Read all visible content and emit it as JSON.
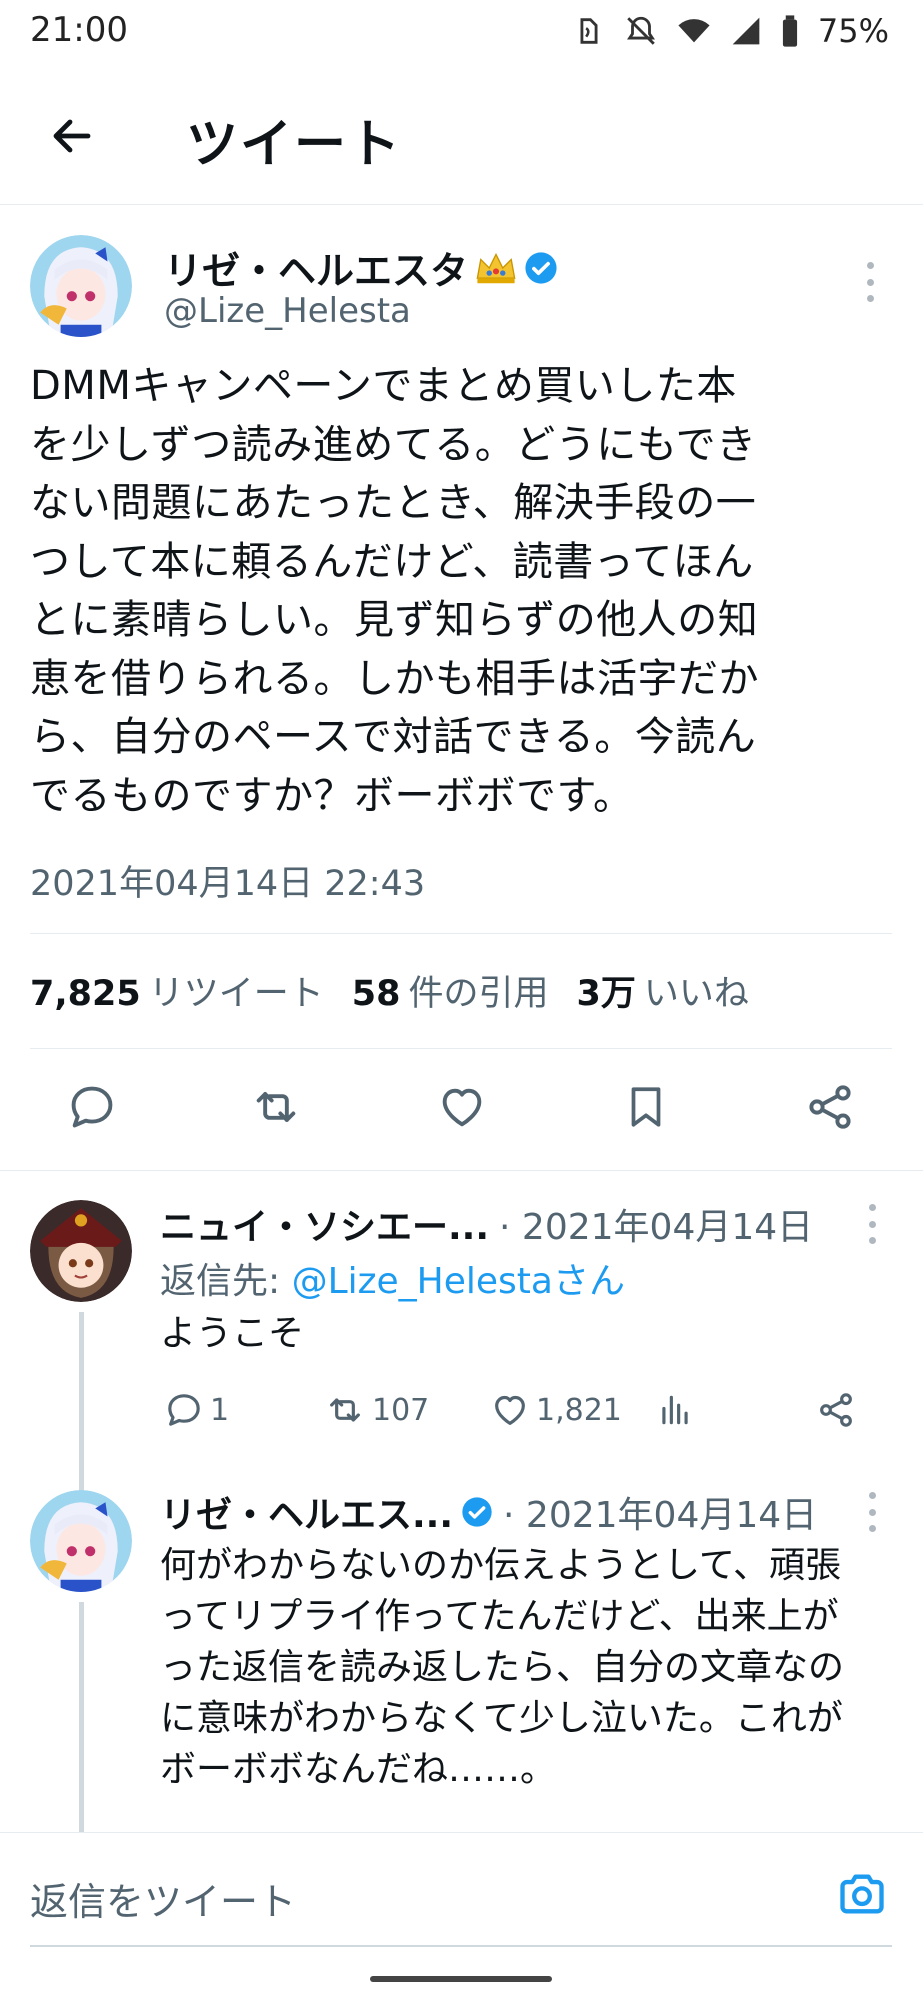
{
  "status_bar": {
    "time": "21:00",
    "battery": "75%"
  },
  "header": {
    "title": "ツイート"
  },
  "main_tweet": {
    "author_name": "リゼ・ヘルエスタ",
    "author_handle": "@Lize_Helesta",
    "text_lines": [
      "DMMキャンペーンでまとめ買いした本",
      "を少しずつ読み進めてる。どうにもでき",
      "ない問題にあたったとき、解決手段の一",
      "つして本に頼るんだけど、読書ってほん",
      "とに素晴らしい。見ず知らずの他人の知",
      "恵を借りられる。しかも相手は活字だか",
      "ら、自分のペースで対話できる。今読ん",
      "でるものですか？ボーボボです。"
    ],
    "timestamp": "2021年04月14日 22:43",
    "stats": {
      "retweets_num": "7,825",
      "retweets_label": "リツイート",
      "quotes_num": "58",
      "quotes_label": "件の引用",
      "likes_num": "3万",
      "likes_label": "いいね"
    }
  },
  "replies": [
    {
      "author_name": "ニュイ・ソシエー...",
      "date": "· 2021年04月14日",
      "reply_to_prefix": "返信先: ",
      "reply_to_mention": "@Lize_Helestaさん",
      "text": "ようこそ",
      "reply_count": "1",
      "retweet_count": "107",
      "like_count": "1,821"
    },
    {
      "author_name": "リゼ・ヘルエス...",
      "date": "· 2021年04月14日",
      "text_lines": [
        "何がわからないのか伝えようとして、頑張",
        "ってリプライ作ってたんだけど、出来上が",
        "った返信を読み返したら、自分の文章なの",
        "に意味がわからなくて少し泣いた。これが",
        "ボーボボなんだね……。"
      ]
    }
  ],
  "compose": {
    "placeholder": "返信をツイート"
  },
  "colors": {
    "accent": "#1d9bf0",
    "secondary_text": "#536471",
    "divider": "#e6ecf0"
  }
}
